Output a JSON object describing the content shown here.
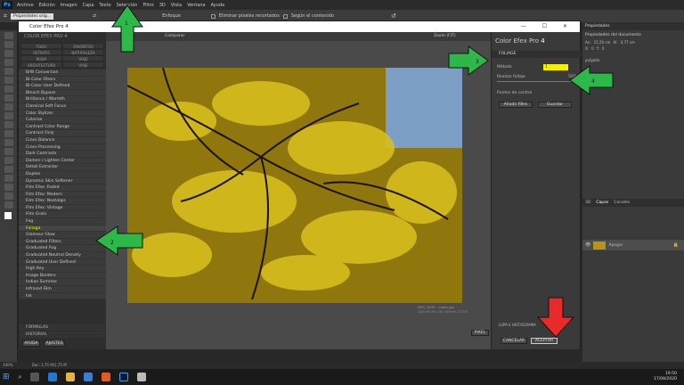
{
  "menubar": {
    "logo": "Ps",
    "items": [
      "Archivo",
      "Edición",
      "Imagen",
      "Capa",
      "Texto",
      "Selección",
      "Filtro",
      "3D",
      "Vista",
      "Ventana",
      "Ayuda"
    ]
  },
  "optbar": {
    "preset": "Propiedades orig...",
    "source": "Enfoque",
    "erase_label": "Eliminar píxeles recortados",
    "content_aware": "Según el contenido"
  },
  "window": {
    "title": "Color Efex Pro 4",
    "controls": "— ☐ ✕"
  },
  "left": {
    "brand": "COLOR EFEX PRO 4",
    "tabs": [
      "TODO",
      "FAVORITOS",
      "RETRATO",
      "NATURALEZA",
      "BODA",
      "VIAJE",
      "ARQUITECTURA",
      "VIAJE"
    ],
    "filters": [
      "B/W Conversion",
      "Bi-Color Filters",
      "Bi-Color User Defined",
      "Bleach Bypass",
      "Brilliance / Warmth",
      "Classical Soft Focus",
      "Color Stylizer",
      "Colorize",
      "Contrast Color Range",
      "Contrast Only",
      "Cross Balance",
      "Cross Processing",
      "Dark Contrasts",
      "Darken / Lighten Center",
      "Detail Extractor",
      "Duplex",
      "Dynamic Skin Softener",
      "Film Efex: Faded",
      "Film Efex: Modern",
      "Film Efex: Nostalgic",
      "Film Efex: Vintage",
      "Film Grain",
      "Fog",
      "Foliage",
      "Glamour Glow",
      "Graduated Filters",
      "Graduated Fog",
      "Graduated Neutral Density",
      "Graduated User Defined",
      "High Key",
      "Image Borders",
      "Indian Summer",
      "Infrared Film",
      "Ink"
    ],
    "selected": "Foliage",
    "formulas": "FÓRMULAS",
    "history": "HISTORIAL",
    "help_btn": "AYUDA",
    "settings_btn": "AJUSTES"
  },
  "center": {
    "compare_label": "Comparar",
    "zoom_label": "Zoom (FIT)",
    "file_name": "DSC_1878 - copia.jpg",
    "file_info": "1/80 f/8 ISO 100 180mm D7100",
    "cancel_btn": "PIXEL"
  },
  "right": {
    "title": "Color Efex Pro",
    "title_num": "4",
    "filter_name": "FOLIAGE",
    "method_label": "Método",
    "method_value": "1",
    "foliage_label": "Realzar follaje",
    "foliage_value": "50%",
    "control_points": "Puntos de control",
    "add_filter": "Añadir filtro",
    "save": "Guardar",
    "loupe": "LUPA E HISTOGRAMA",
    "cancel": "CANCELAR",
    "accept": "ACEPTAR"
  },
  "rightstrip": {
    "props_title": "Propiedades",
    "doc_props": "Propiedades del documento",
    "w_label": "An:",
    "w_value": "15,56 cm",
    "h_label": "Al:",
    "h_value": "4,77 cm",
    "x_label": "X:",
    "x_value": "0",
    "y_label": "Y:",
    "y_value": "0",
    "res_label": "pulgada",
    "layers_tabs": [
      "3D",
      "Capas",
      "Canales"
    ],
    "layer_name": "Apagar"
  },
  "arrows": [
    "1",
    "2",
    "3",
    "4"
  ],
  "status": {
    "zoom": "100%",
    "doc": "Doc: 1,75 M/1,75 M"
  },
  "taskbar": {
    "time": "19:50",
    "date": "17/08/2020"
  },
  "colors": {
    "accent": "#f5f000",
    "arrow_green": "#2db84a",
    "arrow_red": "#e82a2a"
  }
}
